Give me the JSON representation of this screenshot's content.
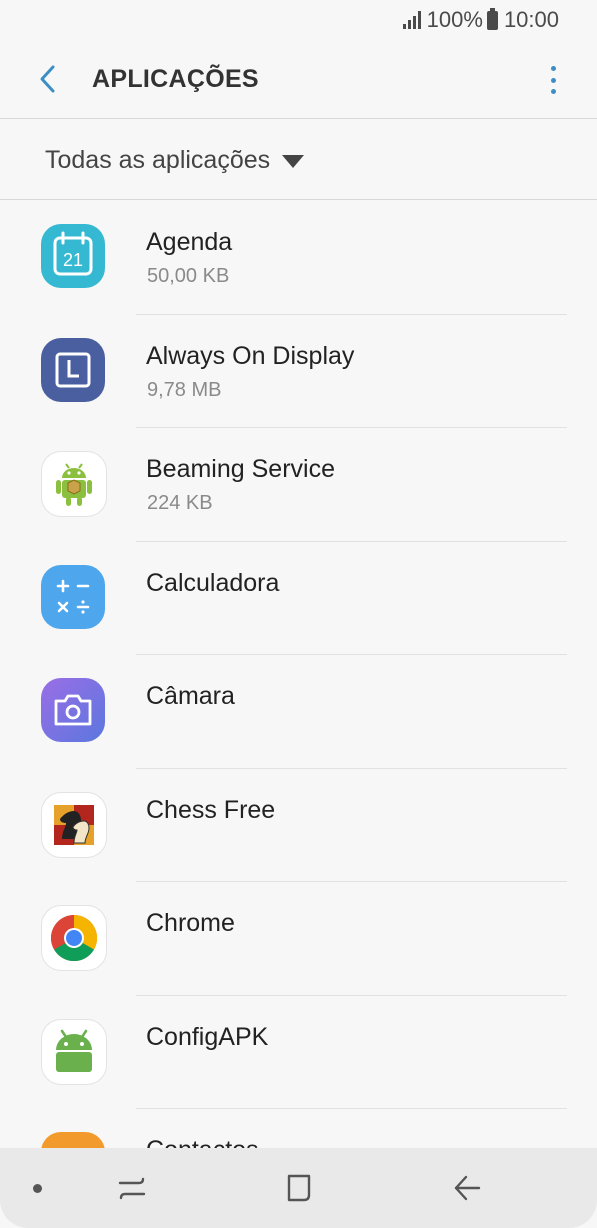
{
  "status_bar": {
    "battery": "100%",
    "time": "10:00"
  },
  "app_bar": {
    "title": "APLICAÇÕES"
  },
  "filter": {
    "selected": "Todas as aplicações"
  },
  "apps": [
    {
      "name": "Agenda",
      "size": "50,00 KB",
      "icon": "calendar-icon"
    },
    {
      "name": "Always On Display",
      "size": "9,78 MB",
      "icon": "clock-display-icon"
    },
    {
      "name": "Beaming Service",
      "size": "224 KB",
      "icon": "android-robot-icon"
    },
    {
      "name": "Calculadora",
      "size": "",
      "icon": "calculator-icon"
    },
    {
      "name": "Câmara",
      "size": "",
      "icon": "camera-icon"
    },
    {
      "name": "Chess Free",
      "size": "",
      "icon": "chess-knight-icon"
    },
    {
      "name": "Chrome",
      "size": "",
      "icon": "chrome-icon"
    },
    {
      "name": "ConfigAPK",
      "size": "",
      "icon": "android-icon"
    },
    {
      "name": "Contactos",
      "size": "",
      "icon": "contacts-icon"
    }
  ],
  "colors": {
    "accent": "#3c8fc4",
    "agenda": "#35b8d1",
    "always_on": "#4a5fa0",
    "calculator": "#4ea6ec",
    "camera": "#7a6fe0",
    "contacts": "#f39a2c"
  }
}
